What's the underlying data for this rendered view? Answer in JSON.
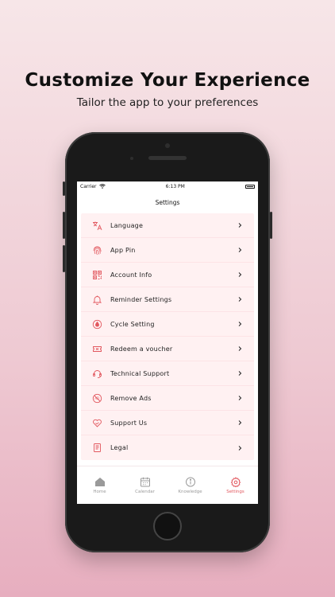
{
  "header": {
    "headline": "Customize Your Experience",
    "subheadline": "Tailor the app to your preferences"
  },
  "status_bar": {
    "carrier": "Carrier",
    "time": "6:13 PM"
  },
  "screen": {
    "title": "Settings"
  },
  "settings": {
    "items": [
      {
        "label": "Language",
        "icon": "translate-icon"
      },
      {
        "label": "App Pin",
        "icon": "fingerprint-icon"
      },
      {
        "label": "Account Info",
        "icon": "qr-code-icon"
      },
      {
        "label": "Reminder Settings",
        "icon": "bell-icon"
      },
      {
        "label": "Cycle Setting",
        "icon": "drop-icon"
      },
      {
        "label": "Redeem a voucher",
        "icon": "ticket-icon"
      },
      {
        "label": "Technical Support",
        "icon": "headset-icon"
      },
      {
        "label": "Remove Ads",
        "icon": "no-ads-icon"
      },
      {
        "label": "Support Us",
        "icon": "heart-hand-icon"
      },
      {
        "label": "Legal",
        "icon": "document-icon"
      }
    ]
  },
  "tabbar": {
    "tabs": [
      {
        "label": "Home",
        "icon": "home-icon",
        "active": false
      },
      {
        "label": "Calendar",
        "icon": "calendar-icon",
        "active": false
      },
      {
        "label": "Knowledge",
        "icon": "info-icon",
        "active": false
      },
      {
        "label": "Settings",
        "icon": "gear-icon",
        "active": true
      }
    ]
  },
  "colors": {
    "accent": "#e2585f",
    "row_background": "#fff1f2",
    "inactive_tab": "#9a9a9a"
  }
}
